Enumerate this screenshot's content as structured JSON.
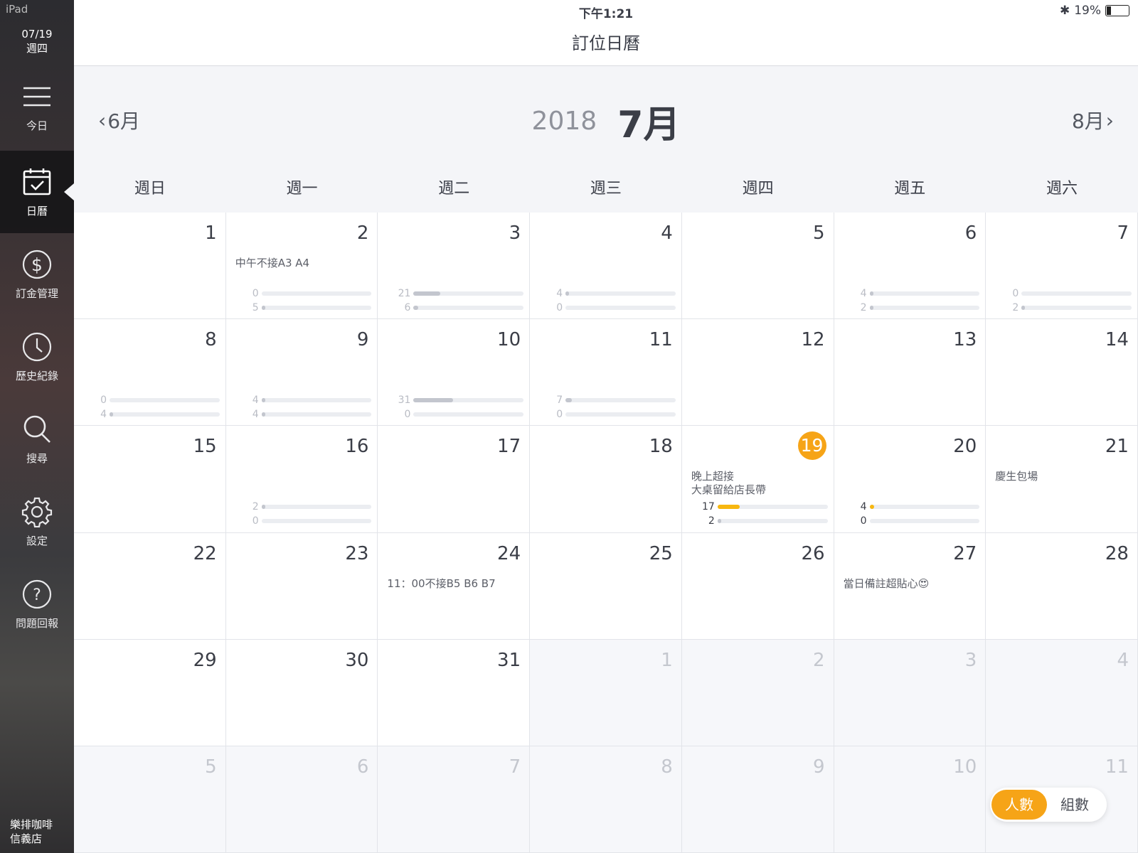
{
  "sidebar": {
    "device": "iPad",
    "date_line1": "07/19",
    "date_line2": "週四",
    "items": [
      {
        "label": "今日",
        "icon": "hamburger-menu-icon"
      },
      {
        "label": "日曆",
        "icon": "calendar-check-icon",
        "active": true
      },
      {
        "label": "訂金管理",
        "icon": "dollar-coin-icon"
      },
      {
        "label": "歷史紀錄",
        "icon": "clock-icon"
      },
      {
        "label": "搜尋",
        "icon": "search-icon"
      },
      {
        "label": "設定",
        "icon": "gear-icon"
      },
      {
        "label": "問題回報",
        "icon": "question-circle-icon"
      }
    ],
    "store_line1": "樂排咖啡",
    "store_line2": "信義店"
  },
  "status": {
    "time": "下午1:21",
    "battery": "19%"
  },
  "header": {
    "title": "訂位日曆"
  },
  "nav": {
    "prev": "6月",
    "next": "8月",
    "year": "2018",
    "month": "7月"
  },
  "weekdays": [
    "週日",
    "週一",
    "週二",
    "週三",
    "週四",
    "週五",
    "週六"
  ],
  "toggle": {
    "people": "人數",
    "groups": "組數",
    "selected": "people"
  },
  "colors": {
    "accent": "#f6a417",
    "bar_gray": "#c3c6ce",
    "bar_orange": "#f7b70f"
  },
  "days": [
    {
      "n": "1"
    },
    {
      "n": "2",
      "note": "中午不接A3 A4",
      "bars": [
        {
          "v": 0,
          "f": 0
        },
        {
          "v": 5,
          "f": 0.03
        }
      ]
    },
    {
      "n": "3",
      "bars": [
        {
          "v": 21,
          "f": 0.24
        },
        {
          "v": 6,
          "f": 0.04
        }
      ]
    },
    {
      "n": "4",
      "bars": [
        {
          "v": 4,
          "f": 0.03
        },
        {
          "v": 0,
          "f": 0
        }
      ]
    },
    {
      "n": "5"
    },
    {
      "n": "6",
      "bars": [
        {
          "v": 4,
          "f": 0.03
        },
        {
          "v": 2,
          "f": 0.02
        }
      ]
    },
    {
      "n": "7",
      "bars": [
        {
          "v": 0,
          "f": 0
        },
        {
          "v": 2,
          "f": 0.02
        }
      ]
    },
    {
      "n": "8",
      "bars": [
        {
          "v": 0,
          "f": 0
        },
        {
          "v": 4,
          "f": 0.03
        }
      ]
    },
    {
      "n": "9",
      "bars": [
        {
          "v": 4,
          "f": 0.03
        },
        {
          "v": 4,
          "f": 0.03
        }
      ]
    },
    {
      "n": "10",
      "bars": [
        {
          "v": 31,
          "f": 0.36
        },
        {
          "v": 0,
          "f": 0
        }
      ]
    },
    {
      "n": "11",
      "bars": [
        {
          "v": 7,
          "f": 0.06
        },
        {
          "v": 0,
          "f": 0
        }
      ]
    },
    {
      "n": "12"
    },
    {
      "n": "13"
    },
    {
      "n": "14"
    },
    {
      "n": "15"
    },
    {
      "n": "16",
      "bars": [
        {
          "v": 2,
          "f": 0.02
        },
        {
          "v": 0,
          "f": 0
        }
      ]
    },
    {
      "n": "17"
    },
    {
      "n": "18"
    },
    {
      "n": "19",
      "today": true,
      "note": "晚上超接\n大桌留給店長帶",
      "bars": [
        {
          "v": 17,
          "f": 0.2,
          "c": "orange"
        },
        {
          "v": 2,
          "f": 0.02
        }
      ]
    },
    {
      "n": "20",
      "hl": true,
      "bars": [
        {
          "v": 4,
          "f": 0.04,
          "c": "orange"
        },
        {
          "v": 0,
          "f": 0
        }
      ]
    },
    {
      "n": "21",
      "note": "慶生包場"
    },
    {
      "n": "22"
    },
    {
      "n": "23"
    },
    {
      "n": "24",
      "note": "11：00不接B5 B6 B7"
    },
    {
      "n": "25"
    },
    {
      "n": "26"
    },
    {
      "n": "27",
      "note": "當日備註超貼心😍"
    },
    {
      "n": "28"
    },
    {
      "n": "29"
    },
    {
      "n": "30"
    },
    {
      "n": "31"
    },
    {
      "n": "1",
      "dim": true
    },
    {
      "n": "2",
      "dim": true
    },
    {
      "n": "3",
      "dim": true
    },
    {
      "n": "4",
      "dim": true
    },
    {
      "n": "5",
      "dim": true
    },
    {
      "n": "6",
      "dim": true
    },
    {
      "n": "7",
      "dim": true
    },
    {
      "n": "8",
      "dim": true
    },
    {
      "n": "9",
      "dim": true
    },
    {
      "n": "10",
      "dim": true
    },
    {
      "n": "11",
      "dim": true
    }
  ]
}
